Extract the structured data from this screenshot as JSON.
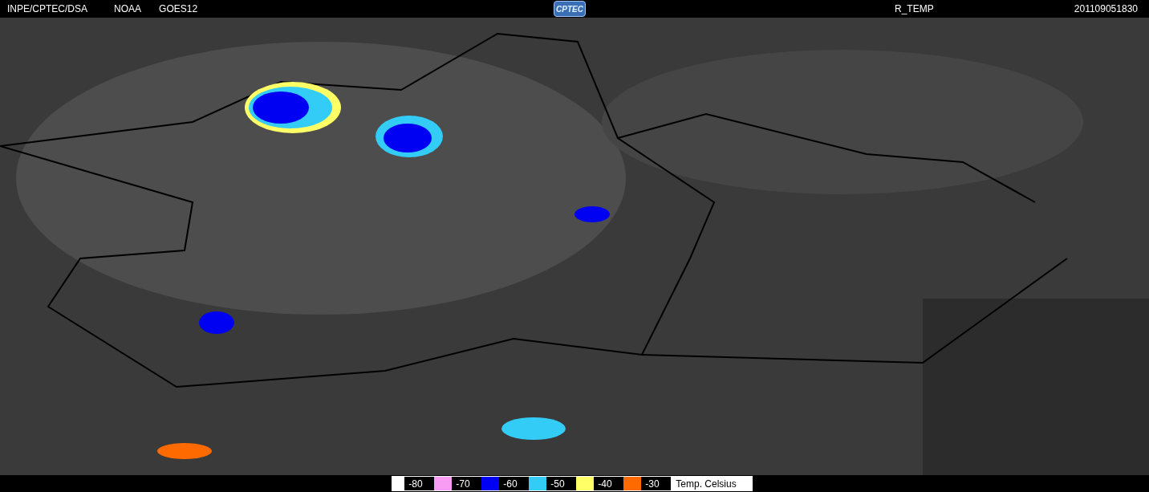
{
  "header": {
    "source": "INPE/CPTEC/DSA",
    "agency": "NOAA",
    "satellite": "GOES12",
    "logo": "CPTEC",
    "product": "R_TEMP",
    "timestamp": "201109051830"
  },
  "legend": {
    "steps": [
      {
        "label": "-80",
        "color": "#f79cf2"
      },
      {
        "label": "-70",
        "color": "#0000f2"
      },
      {
        "label": "-60",
        "color": "#33ccf7"
      },
      {
        "label": "-50",
        "color": "#ffff66"
      },
      {
        "label": "-40",
        "color": "#ff6a00"
      },
      {
        "label": "-30"
      }
    ],
    "unit": "Temp. Celsius"
  }
}
